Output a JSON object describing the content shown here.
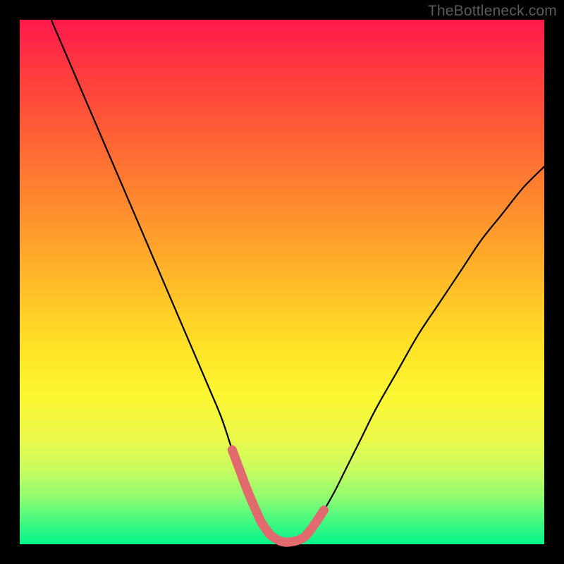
{
  "watermark": "TheBottleneck.com",
  "chart_data": {
    "type": "line",
    "title": "",
    "xlabel": "",
    "ylabel": "",
    "xlim": [
      0,
      100
    ],
    "ylim": [
      0,
      100
    ],
    "series": [
      {
        "name": "black-curve",
        "color": "#000000",
        "x": [
          6,
          9,
          12,
          15,
          18,
          21,
          24,
          27,
          30,
          33,
          36,
          38.5,
          40.5,
          42,
          43.5,
          45,
          46,
          47,
          48,
          50,
          52,
          54,
          55,
          56,
          58,
          60,
          62,
          65,
          68,
          72,
          76,
          80,
          84,
          88,
          92,
          96,
          100
        ],
        "y": [
          100,
          93,
          86,
          79,
          72,
          65,
          58,
          51,
          44,
          37,
          30,
          24,
          18,
          14,
          10,
          6.5,
          4.3,
          2.8,
          1.6,
          0.5,
          0.5,
          1.2,
          2.2,
          3.5,
          6.5,
          10,
          14,
          20,
          26,
          33,
          40,
          46,
          52,
          58,
          63,
          68,
          72
        ]
      },
      {
        "name": "pink-bottom-overlay",
        "color": "#e16a6f",
        "x": [
          40.5,
          42,
          43.5,
          45,
          46,
          47,
          48,
          50,
          52,
          54,
          55,
          56,
          58
        ],
        "y": [
          18,
          14,
          10,
          6.5,
          4.3,
          2.8,
          1.6,
          0.5,
          0.5,
          1.2,
          2.2,
          3.5,
          6.5
        ]
      }
    ]
  }
}
